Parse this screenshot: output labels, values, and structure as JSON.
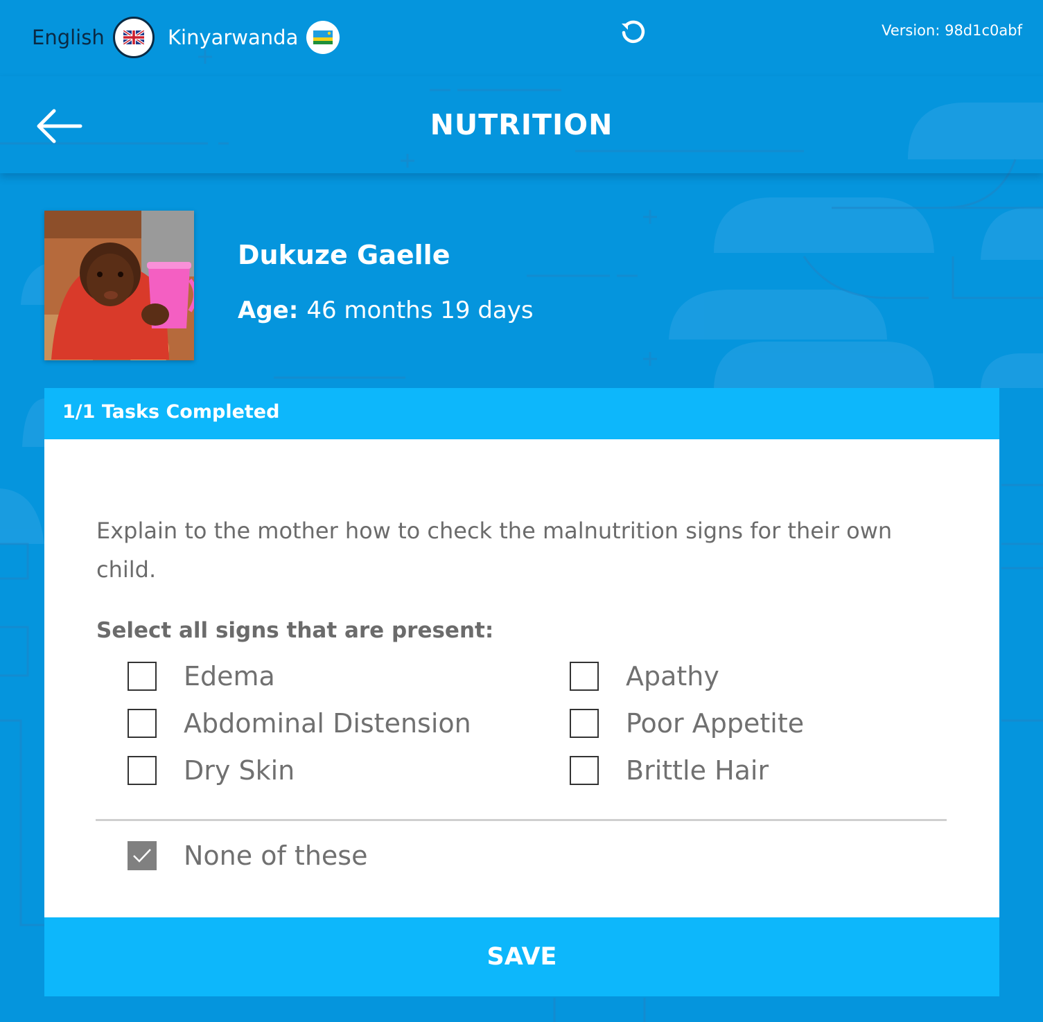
{
  "topbar": {
    "language_english": "English",
    "language_kinyarwanda": "Kinyarwanda",
    "version": "Version: 98d1c0abf"
  },
  "navbar": {
    "title": "NUTRITION"
  },
  "patient": {
    "name": "Dukuze Gaelle",
    "age_label": "Age:",
    "age_value": "46 months 19 days"
  },
  "card": {
    "tasks_status": "1/1 Tasks Completed",
    "instruction": "Explain to the mother how to check the malnutrition signs for their own child.",
    "question": "Select all signs that are present:",
    "options": [
      {
        "label": "Edema",
        "checked": false
      },
      {
        "label": "Apathy",
        "checked": false
      },
      {
        "label": "Abdominal Distension",
        "checked": false
      },
      {
        "label": "Poor Appetite",
        "checked": false
      },
      {
        "label": "Dry Skin",
        "checked": false
      },
      {
        "label": "Brittle Hair",
        "checked": false
      }
    ],
    "none_option": {
      "label": "None of these",
      "checked": true
    },
    "save_label": "SAVE"
  },
  "colors": {
    "background": "#0595dd",
    "accent": "#0db7fb",
    "text_grey": "#6b6b6b"
  },
  "icons": {
    "english": "uk-flag-icon",
    "kinyarwanda": "rwanda-flag-icon",
    "refresh": "refresh-icon",
    "back": "back-arrow-icon"
  }
}
